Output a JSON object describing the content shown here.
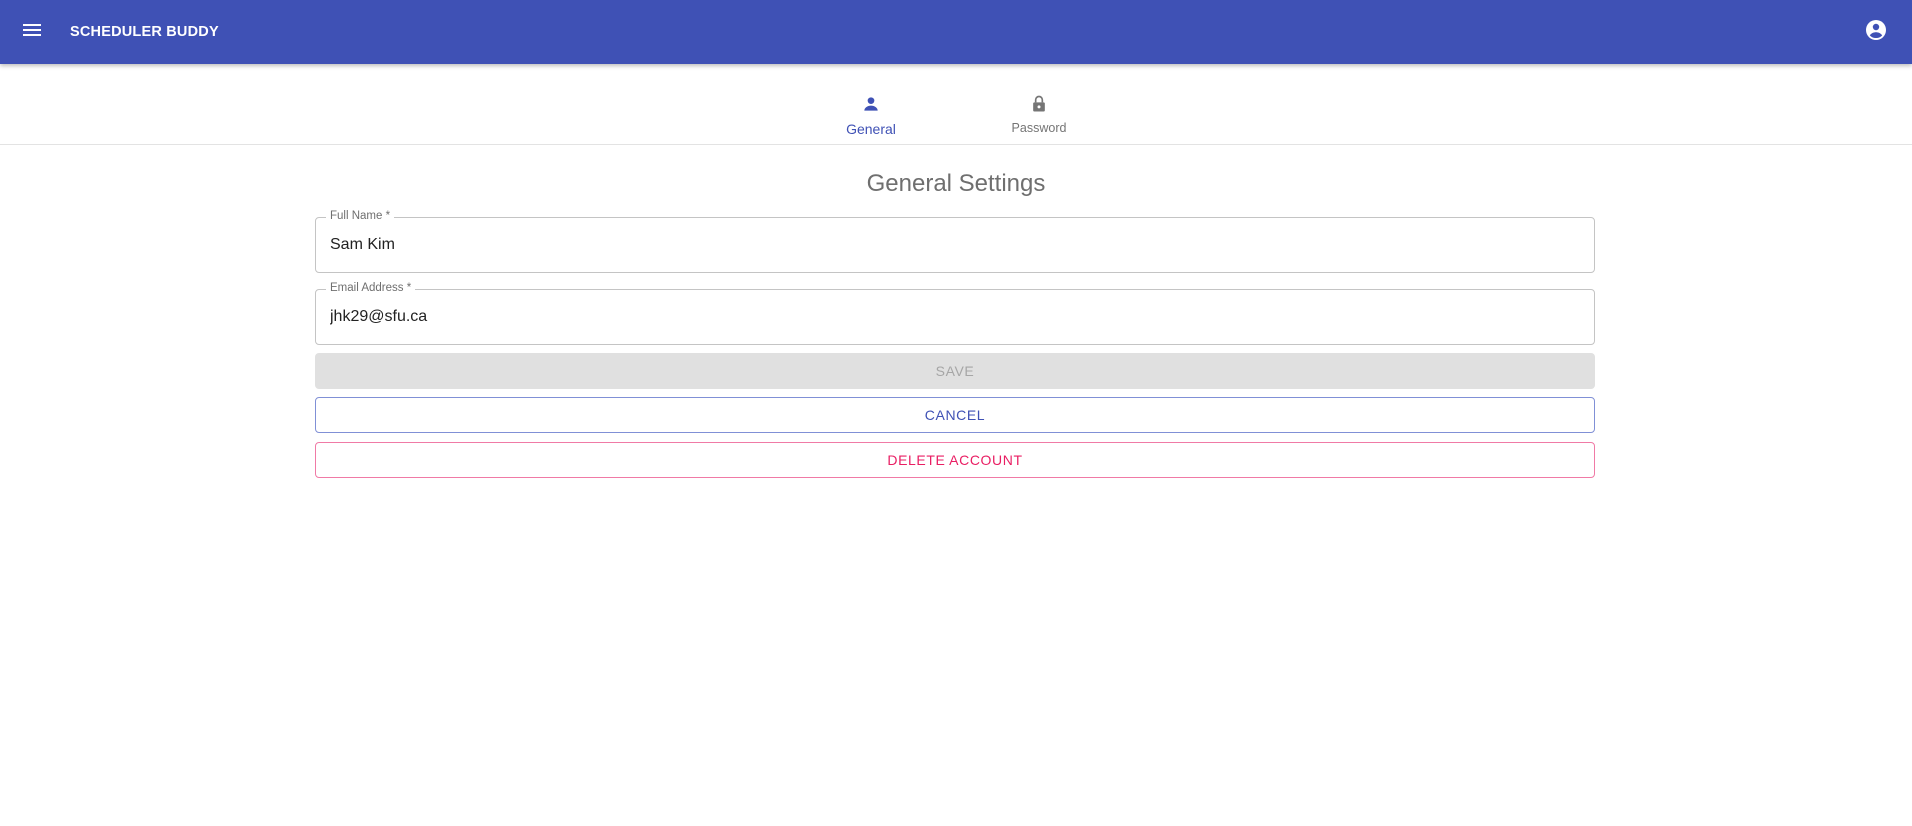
{
  "app": {
    "title": "SCHEDULER BUDDY",
    "menu_icon": "menu-icon",
    "account_icon": "account-circle-icon",
    "colors": {
      "primary": "#3f51b5",
      "secondary": "#e91e63",
      "disabled_bg": "#e0e0e0"
    }
  },
  "tabs": [
    {
      "label": "General",
      "icon": "person-icon",
      "selected": true
    },
    {
      "label": "Password",
      "icon": "lock-icon",
      "selected": false
    }
  ],
  "form": {
    "heading": "General Settings",
    "full_name": {
      "label": "Full Name *",
      "value": "Sam Kim"
    },
    "email": {
      "label": "Email Address *",
      "value": "jhk29@sfu.ca"
    },
    "save_label": "SAVE",
    "cancel_label": "CANCEL",
    "delete_label": "DELETE ACCOUNT"
  }
}
